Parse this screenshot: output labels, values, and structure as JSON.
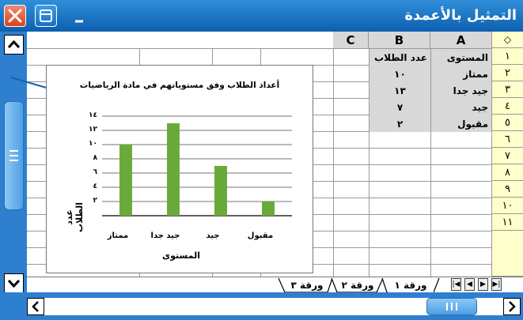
{
  "window": {
    "title": "التمثيل بالأعمدة"
  },
  "colors": {
    "titlebar": "#1a73c8",
    "bar_fill": "#6aaa3a",
    "header_gray": "#d8d8d8",
    "row_header_yellow": "#ffffcc",
    "close_button": "#e0542e"
  },
  "icons": [
    "close-icon",
    "restore-icon",
    "minimize-icon",
    "scroll-up-icon",
    "scroll-down-icon",
    "scroll-left-icon",
    "scroll-right-icon",
    "tab-first-icon",
    "tab-prev-icon",
    "tab-next-icon",
    "tab-last-icon",
    "pointer-arrow-icon"
  ],
  "sheet": {
    "corner_symbol": "◇",
    "columns": [
      "A",
      "B",
      "C"
    ],
    "row_numbers": [
      "١",
      "٢",
      "٣",
      "٤",
      "٥",
      "٦",
      "٧",
      "٨",
      "٩",
      "١٠",
      "١١"
    ],
    "rows": [
      {
        "a": "المستوى",
        "b": "عدد الطلاب"
      },
      {
        "a": "ممتاز",
        "b": "١٠"
      },
      {
        "a": "جيد جدا",
        "b": "١٣"
      },
      {
        "a": "جيد",
        "b": "٧"
      },
      {
        "a": "مقبول",
        "b": "٢"
      }
    ]
  },
  "tabs": [
    "ورقة ١",
    "ورقة ٢",
    "ورقة ٣"
  ],
  "chart_data": {
    "type": "bar",
    "title": "أعداد الطلاب وفق مستوياتهم في مادة الرياضيات",
    "xlabel": "المستوى",
    "ylabel": "عدد الطلاب",
    "categories": [
      "ممتاز",
      "جيد جدا",
      "جيد",
      "مقبول"
    ],
    "values": [
      10,
      13,
      7,
      2
    ],
    "ylim": [
      0,
      14
    ],
    "yticks": [
      "٢",
      "٤",
      "٦",
      "٨",
      "١٠",
      "١٢",
      "١٤"
    ],
    "grid": true
  }
}
